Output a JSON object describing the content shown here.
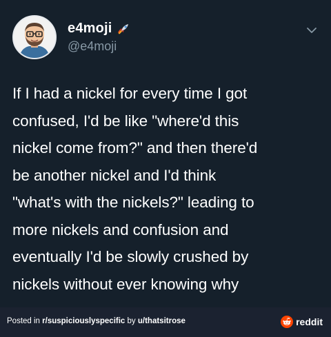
{
  "author": {
    "display_name": "e4moji",
    "handle": "@e4moji",
    "badge_icon": "rocket-icon",
    "avatar": "avatar-cartoon-man-glasses"
  },
  "tweet": {
    "lines": [
      "If I had a nickel for every time I got",
      "confused, I'd be like \"where'd this",
      "nickel come from?\" and then there'd",
      "be another nickel and I'd think",
      "\"what's with the nickels?\" leading to",
      "more nickels and confusion and",
      "eventually I'd be slowly crushed by",
      "nickels without ever knowing why"
    ]
  },
  "footer": {
    "posted_in_prefix": "Posted in ",
    "subreddit": "r/suspiciouslyspecific",
    "by_prefix": " by ",
    "username": "u/thatsitrose",
    "brand_label": "reddit",
    "brand_color": "#ff4500"
  },
  "colors": {
    "card_background": "#15202b",
    "footer_background": "#1b2230",
    "text_primary": "#ffffff",
    "text_secondary": "#8899a6"
  }
}
